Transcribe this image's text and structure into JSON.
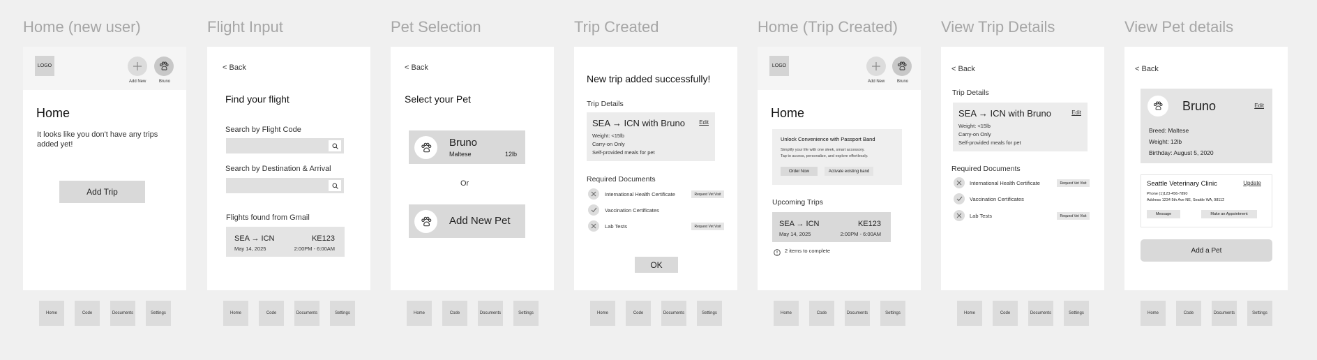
{
  "screens": [
    {
      "title": "Home (new user)"
    },
    {
      "title": "Flight Input"
    },
    {
      "title": "Pet Selection"
    },
    {
      "title": "Trip Created"
    },
    {
      "title": "Home (Trip Created)"
    },
    {
      "title": "View Trip Details"
    },
    {
      "title": "View Pet details"
    }
  ],
  "tabs": {
    "home": "Home",
    "code": "Code",
    "documents": "Documents",
    "settings": "Settings"
  },
  "common": {
    "logo": "LOGO",
    "add_new": "Add New",
    "pet_name": "Bruno",
    "back": "< Back",
    "edit": "Edit"
  },
  "home_new": {
    "heading": "Home",
    "message": "It looks like you don't have any trips added yet!",
    "add_trip": "Add Trip"
  },
  "flight_input": {
    "heading": "Find your flight",
    "search_code_label": "Search by Flight Code",
    "search_dest_label": "Search by Destination & Arrival",
    "found_label": "Flights found from Gmail",
    "flight": {
      "route": "SEA → ICN",
      "number": "KE123",
      "date": "May 14, 2025",
      "time": "2:00PM - 6:00AM"
    }
  },
  "pet_selection": {
    "heading": "Select your Pet",
    "pet_breed": "Maltese",
    "pet_weight": "12lb",
    "or": "Or",
    "add_new_pet": "Add New Pet"
  },
  "trip_details": {
    "route_title": "SEA → ICN with Bruno",
    "weight": "Weight: <15lb",
    "carry": "Carry-on Only",
    "meals": "Self-provided meals for pet",
    "section_label": "Trip Details",
    "docs_label": "Required Documents",
    "docs": [
      {
        "name": "International Health Certificate",
        "action": "Request Vet Visit"
      },
      {
        "name": "Vaccination Certificates",
        "action": ""
      },
      {
        "name": "Lab Tests",
        "action": "Request Vet Visit"
      }
    ]
  },
  "trip_created": {
    "heading": "New trip added successfully!",
    "ok": "OK"
  },
  "home_trip": {
    "heading": "Home",
    "promo_title": "Unlock Convenience with Passport Band",
    "promo_text1": "Simplify your life with one sleek, smart accessory.",
    "promo_text2": "Tap to access, personalize, and explore effortlessly.",
    "order_now": "Order Now",
    "activate": "Activate existing band",
    "upcoming": "Upcoming Trips",
    "items_complete": "2 items to complete"
  },
  "pet_details": {
    "breed": "Breed: Maltese",
    "weight": "Weight: 12lb",
    "birthday": "Birthday: August 5, 2020",
    "clinic": "Seattle Veterinary Clinic",
    "update": "Update",
    "phone": "Phone (1)123-456-7890",
    "address": "Address 1234 5th Ave NE, Seattle WA, 98112",
    "message": "Message",
    "appointment": "Make an Appointment",
    "add_pet": "Add a Pet"
  }
}
